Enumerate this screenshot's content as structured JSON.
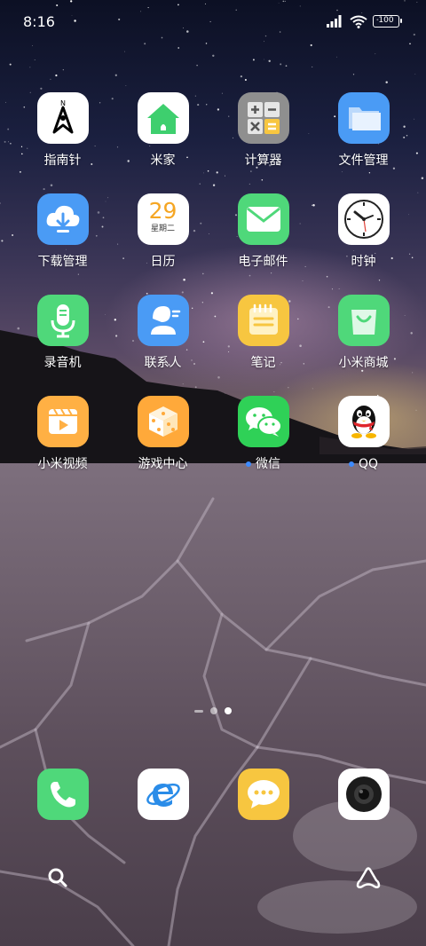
{
  "status_bar": {
    "time": "8:16",
    "battery": "100"
  },
  "apps": [
    {
      "label": "指南针",
      "icon": "compass-icon",
      "badge": false
    },
    {
      "label": "米家",
      "icon": "home-icon",
      "badge": false
    },
    {
      "label": "计算器",
      "icon": "calculator-icon",
      "badge": false
    },
    {
      "label": "文件管理",
      "icon": "folder-icon",
      "badge": false
    },
    {
      "label": "下载管理",
      "icon": "download-cloud-icon",
      "badge": false
    },
    {
      "label": "日历",
      "icon": "calendar-icon",
      "badge": false,
      "calendar_day": "29",
      "calendar_weekday": "星期二"
    },
    {
      "label": "电子邮件",
      "icon": "mail-icon",
      "badge": false
    },
    {
      "label": "时钟",
      "icon": "clock-icon",
      "badge": false
    },
    {
      "label": "录音机",
      "icon": "microphone-icon",
      "badge": false
    },
    {
      "label": "联系人",
      "icon": "contact-icon",
      "badge": false
    },
    {
      "label": "笔记",
      "icon": "notes-icon",
      "badge": false
    },
    {
      "label": "小米商城",
      "icon": "shopping-bag-icon",
      "badge": false
    },
    {
      "label": "小米视频",
      "icon": "video-play-icon",
      "badge": false
    },
    {
      "label": "游戏中心",
      "icon": "dice-icon",
      "badge": false
    },
    {
      "label": "微信",
      "icon": "wechat-icon",
      "badge": true
    },
    {
      "label": "QQ",
      "icon": "qq-penguin-icon",
      "badge": true
    }
  ],
  "dock": [
    {
      "icon": "phone-icon"
    },
    {
      "icon": "browser-icon"
    },
    {
      "icon": "messages-icon"
    },
    {
      "icon": "camera-icon"
    }
  ],
  "page_indicator": {
    "pages": 2,
    "active_page": 2
  },
  "colors": {
    "blue": "#4a9bf5",
    "green": "#4fd87a",
    "yellow": "#f7c640",
    "orange": "#ffa93a",
    "gray": "#8a8a8a",
    "wechat_green": "#2fd157"
  }
}
